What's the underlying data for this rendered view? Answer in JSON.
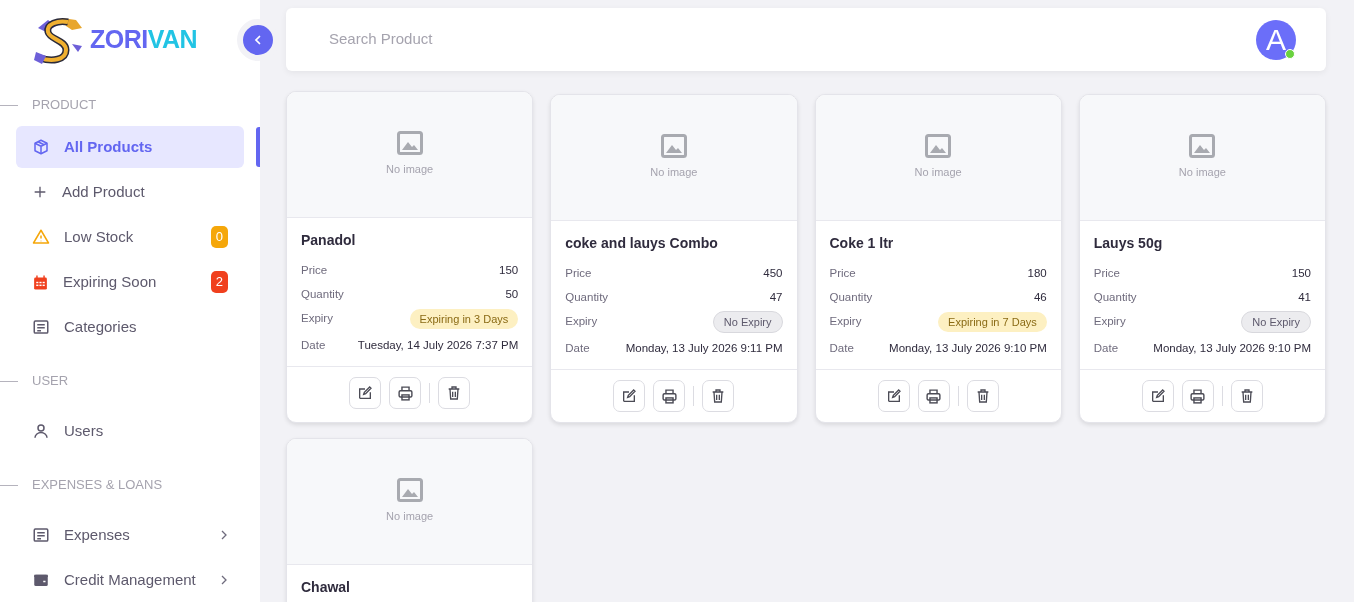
{
  "logo": {
    "parts": [
      {
        "text": "ZORI",
        "color": "#6366f1"
      },
      {
        "text": "VAN",
        "color": "#22c4e4"
      }
    ]
  },
  "sidebar": {
    "sections": [
      {
        "title": "PRODUCT",
        "items": [
          {
            "label": "All Products",
            "selected": true
          },
          {
            "label": "Add Product",
            "selected": false
          },
          {
            "label": "Low Stock",
            "selected": false,
            "badge": "0",
            "color": "#f5a70a"
          },
          {
            "label": "Expiring Soon",
            "selected": false,
            "badge": "2",
            "color": "#f0401e"
          },
          {
            "label": "Categories",
            "selected": false
          }
        ]
      },
      {
        "title": "USER",
        "items": [
          {
            "label": "Users",
            "selected": false
          }
        ]
      },
      {
        "title": "EXPENSES & LOANS",
        "items": [
          {
            "label": "Expenses",
            "selected": false,
            "expandable": true
          },
          {
            "label": "Credit Management",
            "selected": false,
            "expandable": true
          }
        ]
      }
    ]
  },
  "search": {
    "placeholder": "Search Product"
  },
  "user": {
    "initial": "A",
    "online": true
  },
  "products": [
    {
      "image_text": "No image",
      "name": "Panadol",
      "price_label": "Price",
      "price": "150",
      "quantity_label": "Quantity",
      "quantity": "50",
      "expiry_label": "Expiry",
      "expiry": {
        "kind": "expiring",
        "text": "Expiring in 3 Days"
      },
      "date_label": "Date",
      "date": "Tuesday, 14 July 2026 7:37 PM"
    },
    {
      "image_text": "No image",
      "name": "coke and lauys Combo",
      "price_label": "Price",
      "price": "450",
      "quantity_label": "Quantity",
      "quantity": "47",
      "expiry_label": "Expiry",
      "expiry": {
        "kind": "none",
        "text": "No Expiry"
      },
      "date_label": "Date",
      "date": "Monday, 13 July 2026 9:11 PM"
    },
    {
      "image_text": "No image",
      "name": "Coke 1 ltr",
      "price_label": "Price",
      "price": "180",
      "quantity_label": "Quantity",
      "quantity": "46",
      "expiry_label": "Expiry",
      "expiry": {
        "kind": "expiring",
        "text": "Expiring in 7 Days"
      },
      "date_label": "Date",
      "date": "Monday, 13 July 2026 9:10 PM"
    },
    {
      "image_text": "No image",
      "name": "Lauys 50g",
      "price_label": "Price",
      "price": "150",
      "quantity_label": "Quantity",
      "quantity": "41",
      "expiry_label": "Expiry",
      "expiry": {
        "kind": "none",
        "text": "No Expiry"
      },
      "date_label": "Date",
      "date": "Monday, 13 July 2026 9:10 PM"
    },
    {
      "image_text": "No image",
      "name": "Chawal"
    }
  ]
}
